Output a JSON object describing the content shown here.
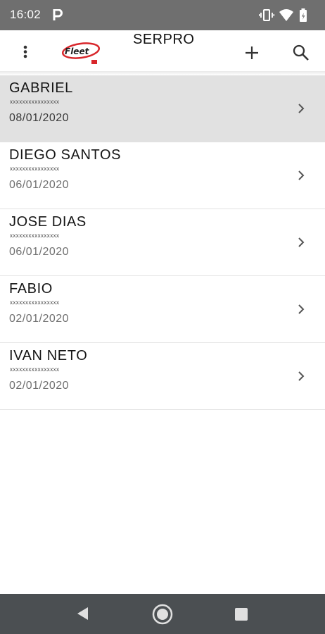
{
  "status_bar": {
    "time": "16:02",
    "icons": [
      "parking-icon",
      "vibrate-icon",
      "wifi-icon",
      "battery-icon"
    ]
  },
  "toolbar": {
    "title": "SERPRO",
    "logo_text": "Fleet",
    "icons": [
      "more-vert-icon",
      "add-icon",
      "search-icon"
    ]
  },
  "colors": {
    "status_bar": "#6f6f6f",
    "nav_bar": "#4b4f52",
    "selected_row": "#e1e1e1",
    "logo_red": "#d8262b"
  },
  "list": {
    "items": [
      {
        "name": "GABRIEL",
        "sub": "xxxxxxxxxxxxxxxx",
        "date": "08/01/2020",
        "selected": true
      },
      {
        "name": "DIEGO SANTOS",
        "sub": "xxxxxxxxxxxxxxxx",
        "date": "06/01/2020",
        "selected": false
      },
      {
        "name": "JOSE DIAS",
        "sub": "xxxxxxxxxxxxxxxx",
        "date": "06/01/2020",
        "selected": false
      },
      {
        "name": "FABIO",
        "sub": "xxxxxxxxxxxxxxxx",
        "date": "02/01/2020",
        "selected": false
      },
      {
        "name": "IVAN NETO",
        "sub": "xxxxxxxxxxxxxxxx",
        "date": "02/01/2020",
        "selected": false
      }
    ]
  },
  "nav_bar": {
    "icons": [
      "back-icon",
      "home-icon",
      "recents-icon"
    ]
  }
}
